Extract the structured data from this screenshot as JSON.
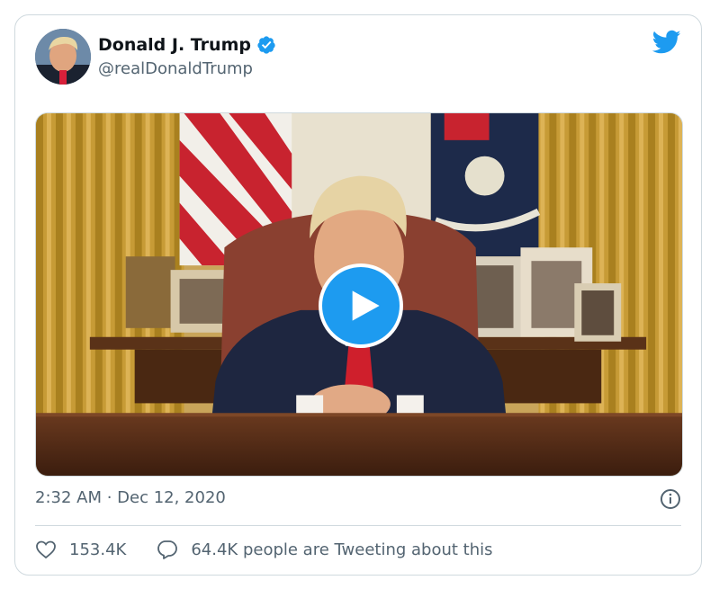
{
  "tweet": {
    "author_name": "Donald J. Trump",
    "author_handle": "@realDonaldTrump",
    "verified_icon": "verified-badge-icon",
    "brand_icon": "twitter-bird-icon",
    "timestamp": "2:32 AM · Dec 12, 2020",
    "likes": "153.4K",
    "replies_text": "64.4K people are Tweeting about this"
  },
  "media": {
    "type": "video",
    "play_icon": "play-icon"
  },
  "colors": {
    "accent": "#1d9bf0",
    "text_primary": "#0f1419",
    "text_secondary": "#536471",
    "border": "#cfd9de"
  }
}
